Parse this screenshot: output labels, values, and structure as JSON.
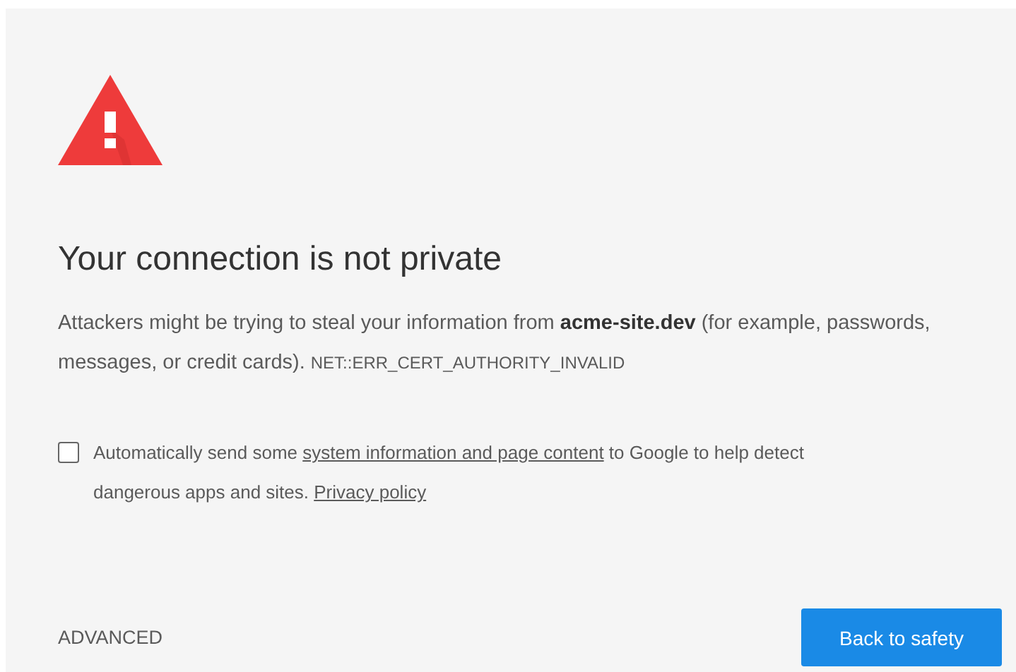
{
  "title": "Your connection is not private",
  "description": "Attackers might be trying to steal your information from **acme-site.dev** (for example, passwords, messages, or credit cards).",
  "error_code": "NET::ERR_CERT_AUTHORITY_INVALID",
  "report": {
    "checked": false,
    "parts": [
      {
        "kind": "text",
        "text": "Automatically send some "
      },
      {
        "kind": "link",
        "text": "system information and page content"
      },
      {
        "kind": "text",
        "text": " to Google to help detect dangerous apps and sites. "
      },
      {
        "kind": "link",
        "text": "Privacy policy"
      }
    ]
  },
  "advanced": "ADVANCED",
  "back_button": "Back to safety"
}
